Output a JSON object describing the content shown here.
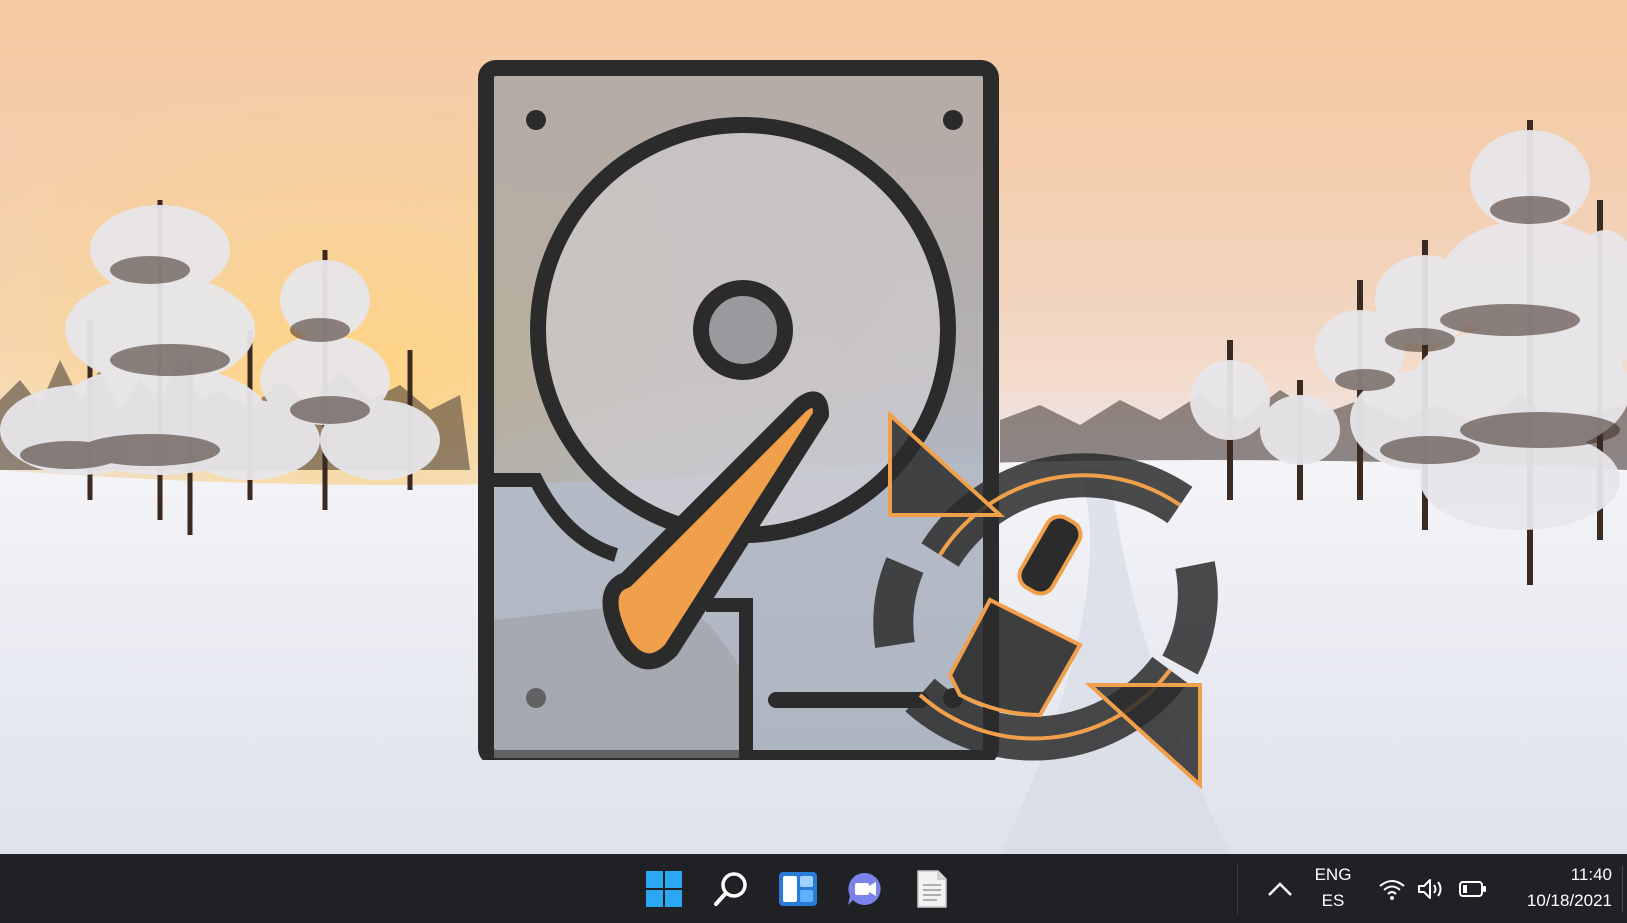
{
  "desktop": {
    "wallpaper": "snowy-forest-sunset",
    "overlay_icons": [
      "hard-drive-icon",
      "disk-cleanup-icon"
    ],
    "accent_color": "#f0a04b"
  },
  "taskbar": {
    "apps": [
      {
        "name": "Start",
        "icon": "windows-start-icon"
      },
      {
        "name": "Search",
        "icon": "search-icon"
      },
      {
        "name": "Widgets",
        "icon": "widgets-icon"
      },
      {
        "name": "Chat",
        "icon": "teams-chat-icon"
      },
      {
        "name": "Notepad",
        "icon": "document-icon"
      }
    ],
    "tray": {
      "language_line1": "ENG",
      "language_line2": "ES",
      "time": "11:40",
      "date": "10/18/2021"
    },
    "colors": {
      "background": "#1f2125",
      "start_blue": "#2aa8f2",
      "chat_purple": "#7b83eb"
    }
  }
}
